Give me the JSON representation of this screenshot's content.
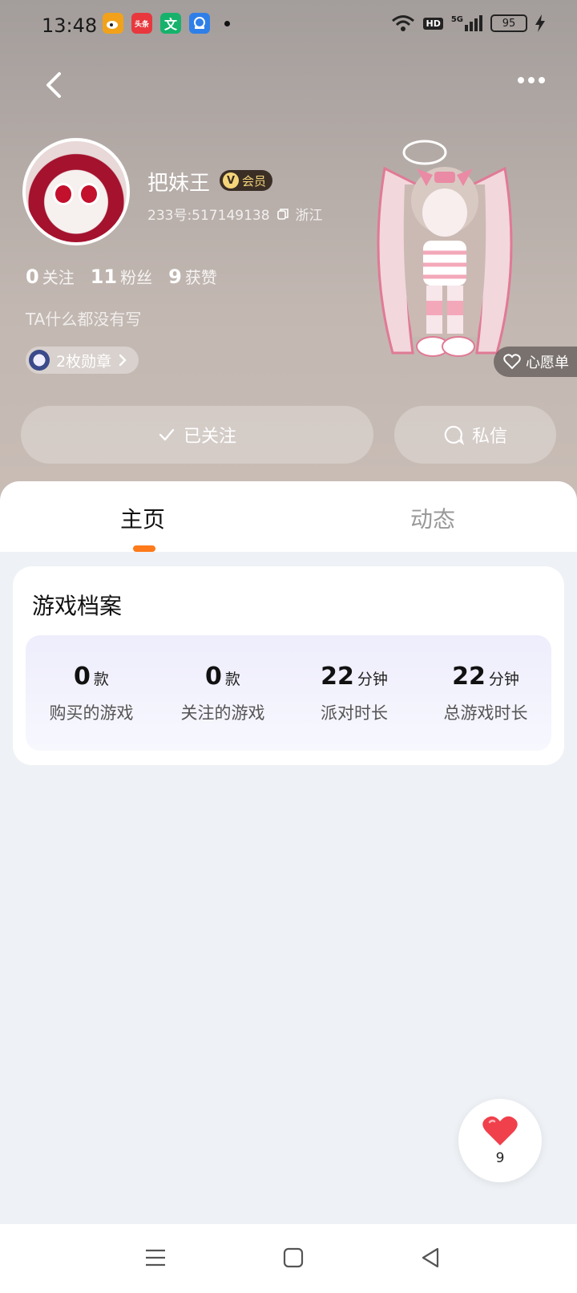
{
  "status": {
    "time": "13:48",
    "apps": [
      {
        "name": "weibo-icon",
        "color": "#f2a21a",
        "label": ""
      },
      {
        "name": "toutiao-icon",
        "color": "#e8383d",
        "label": "头条"
      },
      {
        "name": "wenku-icon",
        "color": "#16b26b",
        "label": "文"
      },
      {
        "name": "browser-icon",
        "color": "#2f7fe8",
        "label": ""
      }
    ],
    "hd": "HD",
    "net": "5G",
    "battery": "95"
  },
  "profile": {
    "name": "把妹王",
    "vip": "会员",
    "uid": "233号:517149138",
    "region": "浙江",
    "following_count": "0",
    "following_label": "关注",
    "fans_count": "11",
    "fans_label": "粉丝",
    "likes_count": "9",
    "likes_label": "获赞",
    "bio": "TA什么都没有写",
    "badges": "2枚勋章",
    "wishlist": "心愿单"
  },
  "actions": {
    "follow": "已关注",
    "message": "私信"
  },
  "tabs": [
    {
      "label": "主页"
    },
    {
      "label": "动态"
    }
  ],
  "game_profile": {
    "title": "游戏档案",
    "items": [
      {
        "value": "0",
        "unit": "款",
        "label": "购买的游戏"
      },
      {
        "value": "0",
        "unit": "款",
        "label": "关注的游戏"
      },
      {
        "value": "22",
        "unit": "分钟",
        "label": "派对时长"
      },
      {
        "value": "22",
        "unit": "分钟",
        "label": "总游戏时长"
      }
    ]
  },
  "like_button": {
    "count": "9",
    "color": "#f0404c"
  },
  "colors": {
    "accent": "#ff7a1a",
    "vip_gold": "#f5d57a"
  }
}
